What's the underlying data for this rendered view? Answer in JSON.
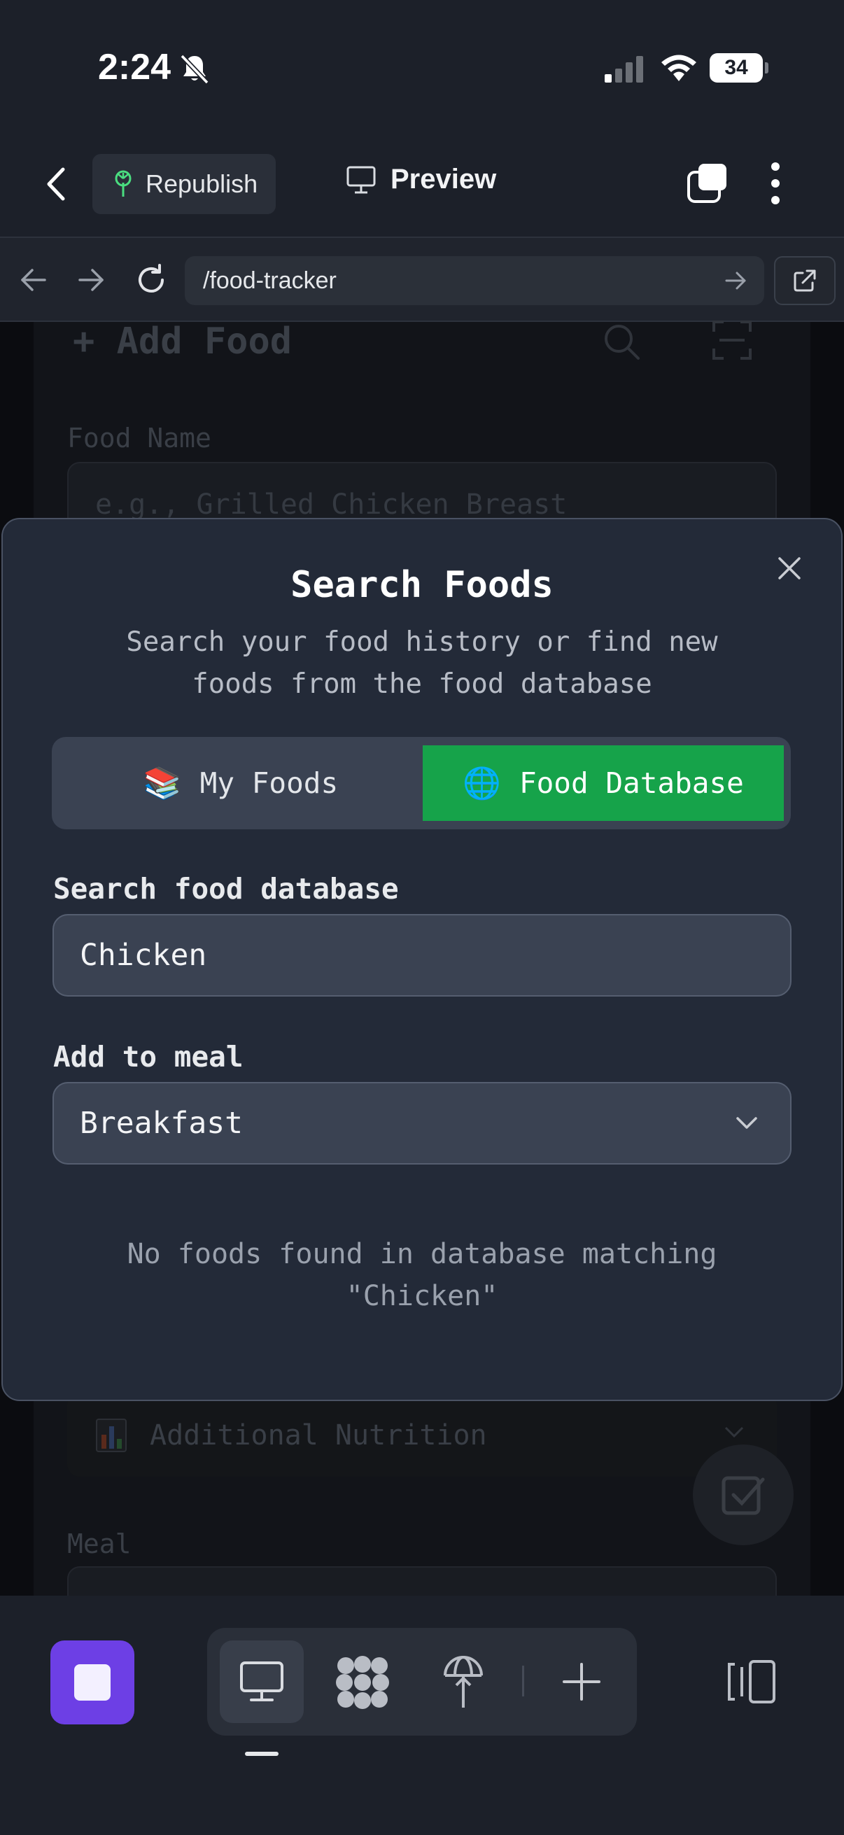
{
  "status_bar": {
    "time": "2:24",
    "battery": "34"
  },
  "header": {
    "republish_label": "Republish",
    "preview_label": "Preview"
  },
  "browser": {
    "url": "/food-tracker"
  },
  "background": {
    "add_food_title": "+ Add Food",
    "food_name_label": "Food Name",
    "food_name_placeholder": "e.g., Grilled Chicken Breast",
    "additional_nutrition": "Additional Nutrition",
    "meal_label": "Meal"
  },
  "modal": {
    "title": "Search Foods",
    "subtitle": "Search your food history or find new foods from the food database",
    "tabs": [
      {
        "emoji": "📚",
        "label": "My Foods",
        "active": false
      },
      {
        "emoji": "🌐",
        "label": "Food Database",
        "active": true
      }
    ],
    "search_label": "Search food database",
    "search_value": "Chicken",
    "meal_label": "Add to meal",
    "meal_value": "Breakfast",
    "empty_message": "No foods found in database matching \"Chicken\""
  },
  "colors": {
    "accent_green": "#16a34a",
    "modal_bg": "#232a38",
    "stop_purple": "#6d3fe5"
  },
  "icons": [
    "bell-slash-icon",
    "signal-icon",
    "wifi-icon",
    "back-chevron-icon",
    "sprout-icon",
    "monitor-icon",
    "windows-icon",
    "kebab-icon",
    "arrow-left-icon",
    "arrow-right-icon",
    "reload-icon",
    "external-link-icon",
    "close-icon",
    "chevron-down-icon",
    "database-icon",
    "deploy-icon",
    "plus-icon",
    "split-view-icon"
  ]
}
